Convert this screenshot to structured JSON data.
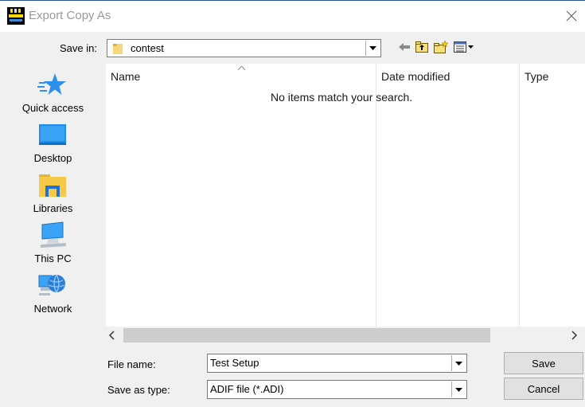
{
  "window": {
    "title": "Export Copy As"
  },
  "save_in": {
    "label": "Save in:",
    "value": "contest"
  },
  "toolbar": {
    "icons": [
      "back-arrow-icon",
      "up-folder-icon",
      "new-folder-icon",
      "view-menu-icon"
    ]
  },
  "places": [
    {
      "label": "Quick access",
      "icon": "star-icon"
    },
    {
      "label": "Desktop",
      "icon": "desktop-icon"
    },
    {
      "label": "Libraries",
      "icon": "libraries-icon"
    },
    {
      "label": "This PC",
      "icon": "computer-icon"
    },
    {
      "label": "Network",
      "icon": "network-icon"
    }
  ],
  "file_list": {
    "columns": [
      "Name",
      "Date modified",
      "Type"
    ],
    "empty_message": "No items match your search."
  },
  "filename": {
    "label": "File name:",
    "value": "Test Setup"
  },
  "filetype": {
    "label": "Save as type:",
    "value": "ADIF file (*.ADI)"
  },
  "buttons": {
    "save": "Save",
    "cancel": "Cancel"
  }
}
